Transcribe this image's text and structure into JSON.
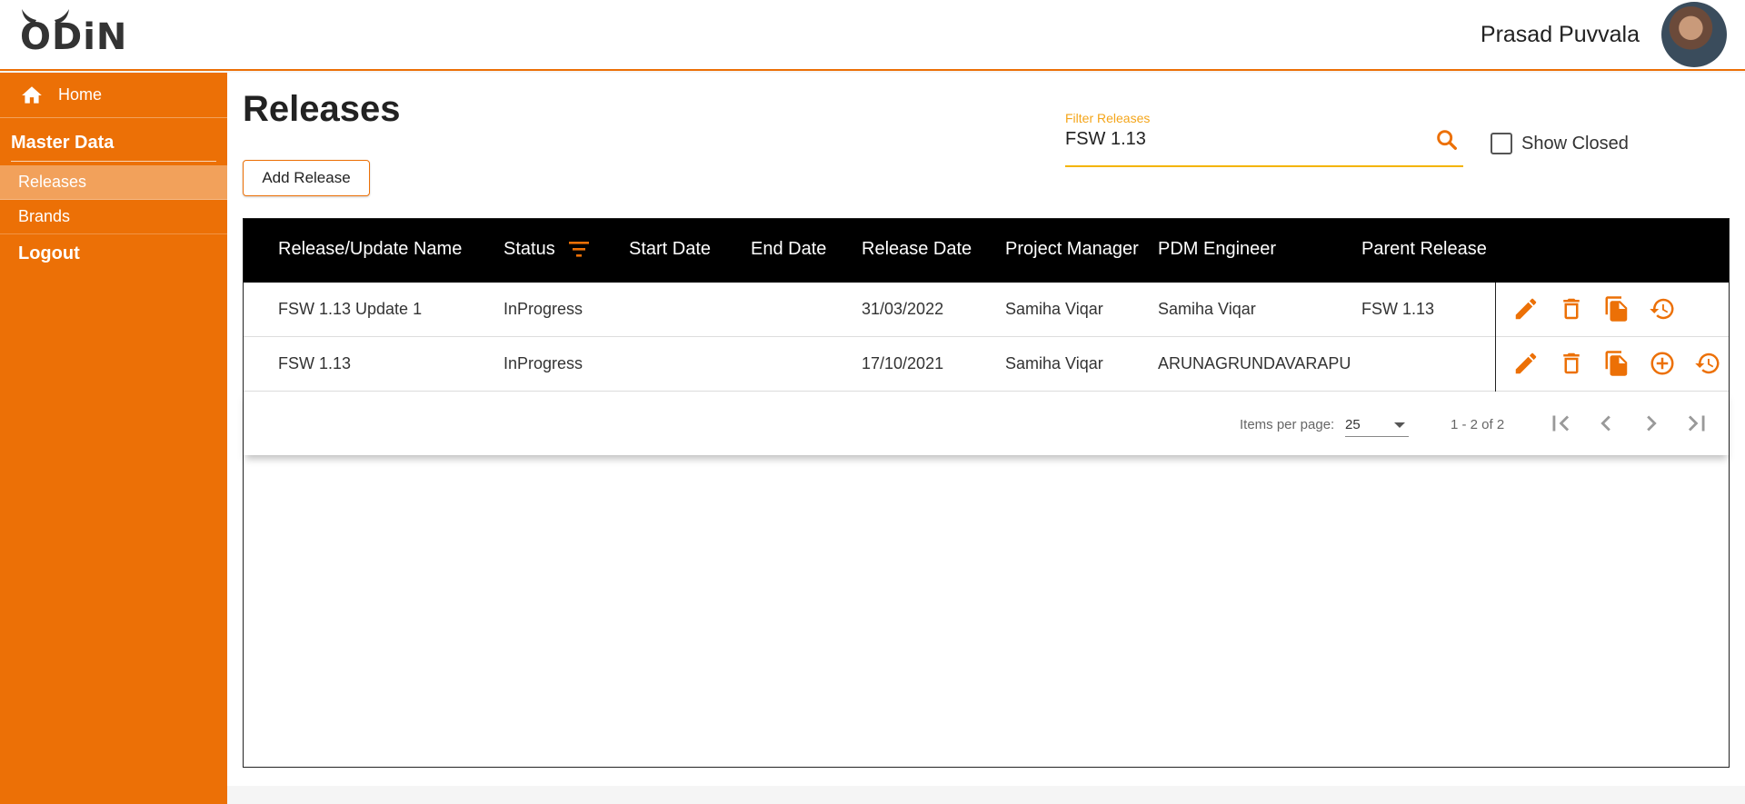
{
  "app": {
    "logo_text": "ODiN",
    "user_name": "Prasad Puvvala",
    "accent_color": "#ec7006"
  },
  "sidebar": {
    "home_label": "Home",
    "section_title": "Master Data",
    "items": [
      {
        "label": "Releases",
        "active": true
      },
      {
        "label": "Brands",
        "active": false
      }
    ],
    "logout_label": "Logout"
  },
  "main": {
    "title": "Releases",
    "add_button_label": "Add Release",
    "filter": {
      "label": "Filter Releases",
      "value": "FSW 1.13"
    },
    "show_closed_label": "Show Closed",
    "show_closed_checked": false
  },
  "table": {
    "columns": [
      "Release/Update Name",
      "Status",
      "Start Date",
      "End Date",
      "Release Date",
      "Project Manager",
      "PDM Engineer",
      "Parent Release"
    ],
    "rows": [
      {
        "name": "FSW 1.13 Update 1",
        "status": "InProgress",
        "start_date": "",
        "end_date": "",
        "release_date": "31/03/2022",
        "project_manager": "Samiha Viqar",
        "pdm_engineer": "Samiha Viqar",
        "parent_release": "FSW 1.13",
        "actions": [
          "edit-icon",
          "delete-icon",
          "copy-icon",
          "history-icon"
        ]
      },
      {
        "name": "FSW 1.13",
        "status": "InProgress",
        "start_date": "",
        "end_date": "",
        "release_date": "17/10/2021",
        "project_manager": "Samiha Viqar",
        "pdm_engineer": "ARUNAGRUNDAVARAPU",
        "parent_release": "",
        "actions": [
          "edit-icon",
          "delete-icon",
          "copy-icon",
          "add-circle-icon",
          "history-icon"
        ]
      }
    ]
  },
  "paginator": {
    "items_per_page_label": "Items per page:",
    "items_per_page": "25",
    "range_label": "1 - 2 of 2"
  }
}
